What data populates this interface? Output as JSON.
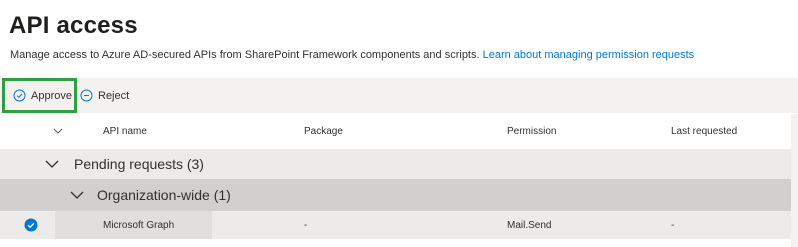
{
  "page": {
    "title": "API access",
    "description": "Manage access to Azure AD-secured APIs from SharePoint Framework components and scripts. ",
    "learn_link": "Learn about managing permission requests"
  },
  "toolbar": {
    "approve_label": "Approve",
    "reject_label": "Reject"
  },
  "table": {
    "columns": [
      "API name",
      "Package",
      "Permission",
      "Last requested"
    ],
    "groups": [
      {
        "label": "Pending requests (3)",
        "subgroups": [
          {
            "label": "Organization-wide (1)",
            "rows": [
              {
                "api_name": "Microsoft Graph",
                "package": "-",
                "permission": "Mail.Send",
                "last_requested": "-",
                "selected": true
              }
            ]
          }
        ]
      }
    ]
  },
  "colors": {
    "accent": "#0078d4",
    "highlight_border": "#2ea043"
  },
  "icons": {
    "approve": "check-circle-icon",
    "reject": "minus-circle-icon",
    "group_toggle": "chevron-down-icon",
    "row_selected": "checkmark-filled-circle-icon"
  }
}
